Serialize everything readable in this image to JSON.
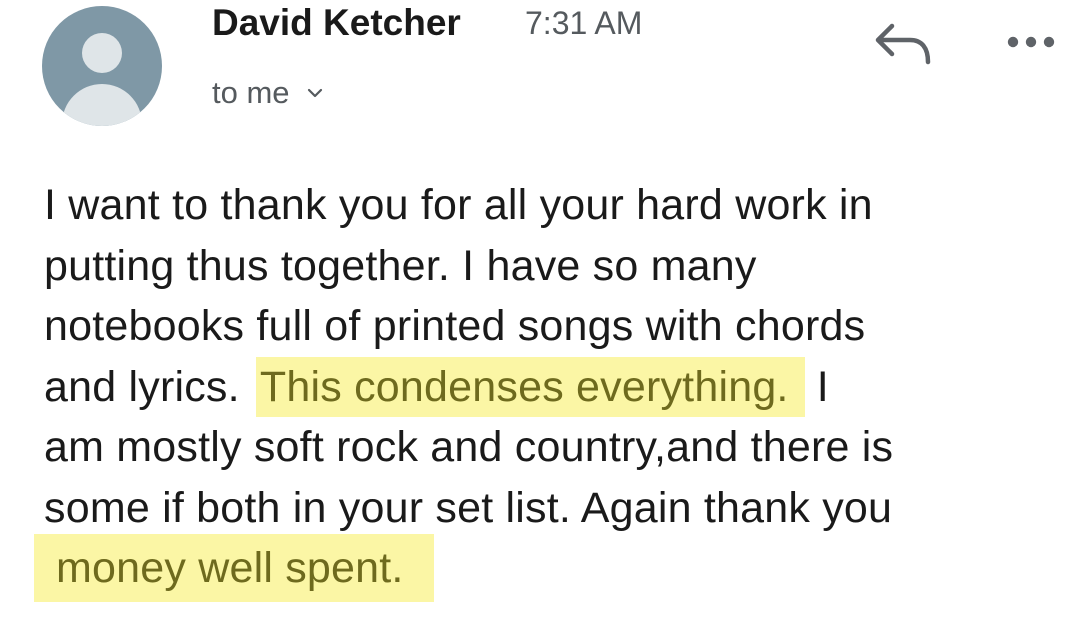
{
  "email": {
    "sender_name": "David Ketcher",
    "time": "7:31 AM",
    "recipient_label": "to me",
    "body": {
      "line1": "I want to thank you for all your hard work in",
      "line2": "putting thus together. I have so many",
      "line3": "notebooks full of printed songs with chords",
      "line4_pre": "and lyrics.",
      "line4_highlight": "This condenses everything.",
      "line4_post": "I",
      "line5": "am mostly soft rock and country,and there is",
      "line6": "some if both in your set list. Again thank you",
      "line7_highlight": "money well spent."
    }
  },
  "icons": {
    "avatar": "avatar-placeholder-icon",
    "recipient_toggle": "chevron-down-icon",
    "reply": "reply-arrow-icon",
    "more": "more-horizontal-icon"
  },
  "colors": {
    "highlight_bg": "#fbf6a5",
    "highlight_text": "#6e6a1e",
    "avatar_bg": "#7f98a6"
  }
}
